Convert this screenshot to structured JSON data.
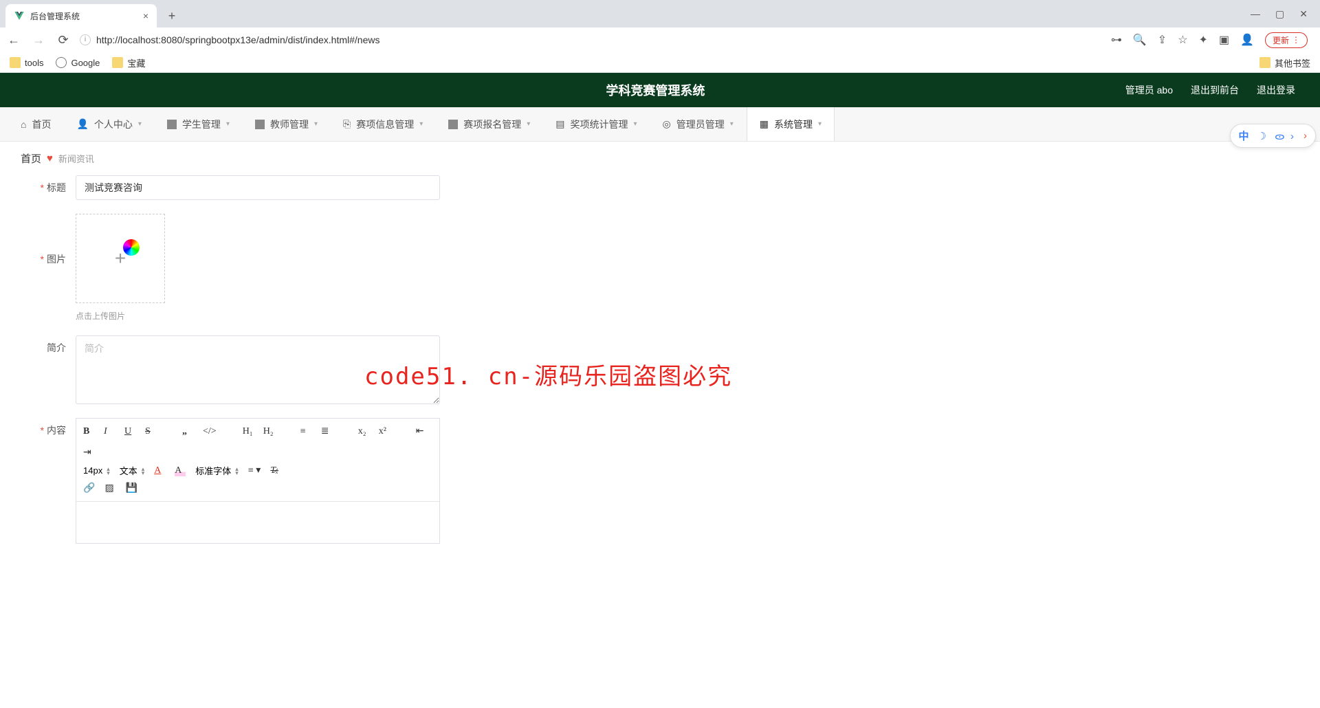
{
  "browser": {
    "tab_title": "后台管理系统",
    "url": "http://localhost:8080/springbootpx13e/admin/dist/index.html#/news",
    "bookmarks": {
      "tools": "tools",
      "google": "Google",
      "treasure": "宝藏",
      "other": "其他书签"
    },
    "update_label": "更新"
  },
  "header": {
    "title": "学科竞赛管理系统",
    "user_label": "管理员 abo",
    "logout_front": "退出到前台",
    "logout": "退出登录"
  },
  "nav": {
    "home": "首页",
    "personal": "个人中心",
    "student": "学生管理",
    "teacher": "教师管理",
    "contest_info": "赛项信息管理",
    "contest_reg": "赛项报名管理",
    "award": "奖项统计管理",
    "admin": "管理员管理",
    "system": "系统管理"
  },
  "breadcrumb": {
    "home": "首页",
    "current": "新闻资讯"
  },
  "form": {
    "title_label": "标题",
    "title_value": "测试竞赛咨询",
    "image_label": "图片",
    "upload_hint": "点击上传图片",
    "intro_label": "简介",
    "intro_placeholder": "简介",
    "content_label": "内容"
  },
  "editor": {
    "fontsize": "14px",
    "blocktype": "文本",
    "fontfamily": "标准字体"
  },
  "ime": {
    "lang": "中"
  },
  "watermark": {
    "big": "code51. cn-源码乐园盗图必究",
    "small": "code51.cn"
  }
}
